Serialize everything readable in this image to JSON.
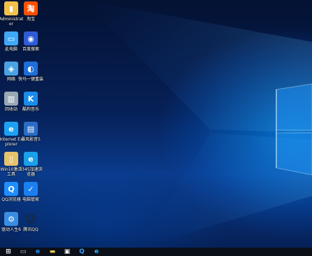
{
  "desktop": {
    "icons": [
      {
        "label": "Administrator",
        "icon": "user-folder-icon",
        "color": "#f3c14a"
      },
      {
        "label": "淘宝",
        "icon": "taobao-icon",
        "color": "#ff5000"
      },
      {
        "label": "此电脑",
        "icon": "computer-icon",
        "color": "#3fa9f5"
      },
      {
        "label": "百度搜索",
        "icon": "baidu-icon",
        "color": "#2f5bd8"
      },
      {
        "label": "网络",
        "icon": "network-icon",
        "color": "#4aa3e0"
      },
      {
        "label": "快马一键重装",
        "icon": "kuaima-icon",
        "color": "#1e6fd9"
      },
      {
        "label": "回收站",
        "icon": "recycle-bin-icon",
        "color": "#9aa7b5"
      },
      {
        "label": "酷狗音乐",
        "icon": "kugou-icon",
        "color": "#1a8be8"
      },
      {
        "label": "Internet Explorer",
        "icon": "internet-explorer-icon",
        "color": "#1ea1f2"
      },
      {
        "label": "暴风影音5",
        "icon": "baofeng-icon",
        "color": "#2b6cc4"
      },
      {
        "label": "Win10激活工具",
        "icon": "activation-tool-icon",
        "color": "#e6c36a"
      },
      {
        "label": "2345加速浏览器",
        "icon": "browser-2345-icon",
        "color": "#1aa0e8"
      },
      {
        "label": "QQ浏览器",
        "icon": "qq-browser-icon",
        "color": "#1f8fff"
      },
      {
        "label": "电脑管家",
        "icon": "pc-manager-icon",
        "color": "#1b7ff0"
      },
      {
        "label": "驱动人生6",
        "icon": "driver-life-icon",
        "color": "#3a8de0"
      },
      {
        "label": "腾讯QQ",
        "icon": "tencent-qq-icon",
        "color": "#e8e8e8"
      }
    ]
  },
  "taskbar": {
    "items": [
      {
        "icon": "windows-start-icon"
      },
      {
        "icon": "task-view-icon"
      },
      {
        "icon": "edge-browser-icon"
      },
      {
        "icon": "file-explorer-icon"
      },
      {
        "icon": "store-icon"
      },
      {
        "icon": "qq-browser-icon"
      },
      {
        "icon": "browser-2345-icon"
      }
    ]
  }
}
